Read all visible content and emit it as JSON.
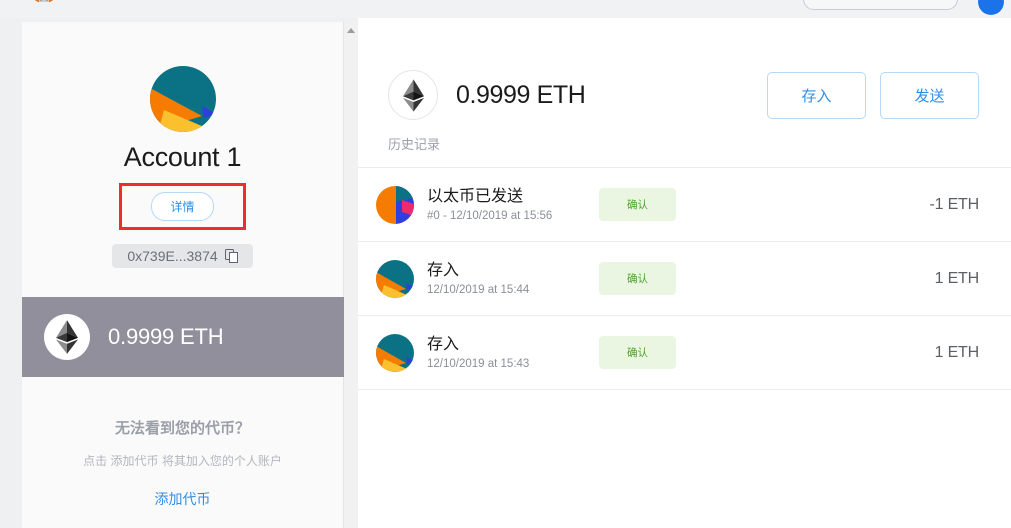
{
  "browser": {
    "extension_icon": "metamask-fox-icon",
    "address_bar_placeholder": "",
    "profile_avatar": "user-avatar"
  },
  "sidebar": {
    "identicon": "account-jazzicon",
    "account_name": "Account 1",
    "details_label": "详情",
    "address": "0x739E...3874",
    "copy_icon": "copy-icon",
    "token": {
      "icon": "ethereum-icon",
      "amount": "0.9999 ETH"
    },
    "no_tokens": {
      "title": "无法看到您的代币？",
      "description": "点击 添加代币 将其加入您的个人账户",
      "add_link": "添加代币"
    }
  },
  "main": {
    "token_icon": "ethereum-icon",
    "balance": "0.9999 ETH",
    "deposit_label": "存入",
    "send_label": "发送",
    "history_tab": "历史记录",
    "transactions": [
      {
        "icon": "tx-jazzicon-1",
        "title": "以太币已发送",
        "subtitle": "#0 - 12/10/2019 at 15:56",
        "status": "确认",
        "amount": "-1 ETH"
      },
      {
        "icon": "tx-jazzicon-2",
        "title": "存入",
        "subtitle": "12/10/2019 at 15:44",
        "status": "确认",
        "amount": "1 ETH"
      },
      {
        "icon": "tx-jazzicon-3",
        "title": "存入",
        "subtitle": "12/10/2019 at 15:43",
        "status": "确认",
        "amount": "1 ETH"
      }
    ]
  },
  "annotation": {
    "highlight_color": "#f02d2d",
    "target": "details-button"
  },
  "colors": {
    "accent_blue": "#2f8fe8",
    "selected_token_bg": "#918f9b",
    "status_green_bg": "#eaf6e1",
    "status_green_text": "#4f9e33",
    "page_bg": "#eff0f2"
  }
}
